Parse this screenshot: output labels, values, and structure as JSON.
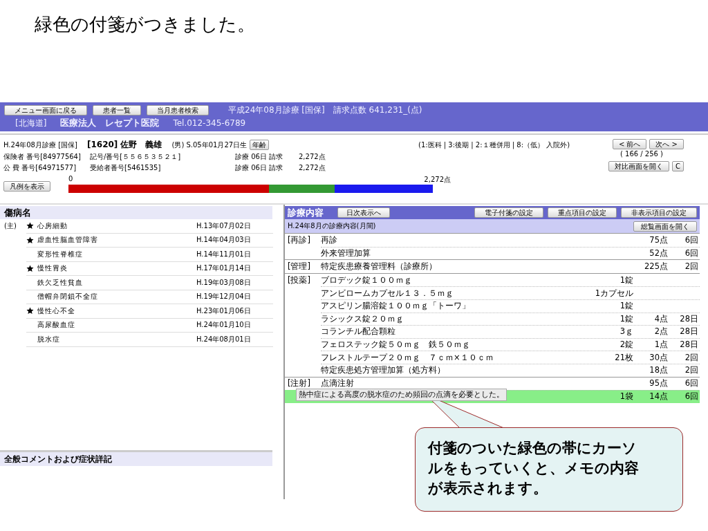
{
  "slide_title": "緑色の付箋がつきました。",
  "header": {
    "buttons": [
      "メニュー画面に戻る",
      "患者一覧",
      "当月患者検索"
    ],
    "title": "平成24年08月診療 [国保]　請求点数 641,231_(点)",
    "prefecture": "[北海道]",
    "clinic": "医療法人　レセプト医院",
    "tel": "Tel.012-345-6789"
  },
  "patient": {
    "month": "H.24年08月診療 [国保]",
    "name": "[1620] 佐野　義雄",
    "birth": "(男) S.05年01月27日生",
    "age_button": "年齢",
    "lines": [
      {
        "number": "保険者 番号[84977564]",
        "id": "記号/番号[５５６５３５２１]",
        "visits": "診療 06日 請求",
        "points": "2,272点"
      },
      {
        "number": "公 費 番号[64971577]",
        "id": "受給者番号[5461535]",
        "visits": "診療 06日 請求",
        "points": "2,272点"
      }
    ],
    "type": "(1:医科 | 3:後期 | 2:１種併用 | 8:（低） 入院外)",
    "prev_button": "< 前へ",
    "next_button": "次へ >",
    "counter": "( 166 / 256 )",
    "compare_button": "対比画面を開く",
    "clear_button": "C"
  },
  "legend_button": "凡例を表示",
  "bar": {
    "start_label": "0",
    "end_label": "2,272点",
    "segments": [
      {
        "color": "#cc0000"
      },
      {
        "color": "#339933"
      },
      {
        "color": "#1a1aee"
      }
    ]
  },
  "diseases": {
    "title": "傷病名",
    "rows": [
      {
        "prefix": "(主)",
        "starred": true,
        "name": "心房細動",
        "date": "H.13年07月02日"
      },
      {
        "starred": true,
        "name": "虚血性脳血管障害",
        "date": "H.14年04月03日"
      },
      {
        "starred": false,
        "name": "変形性脊椎症",
        "date": "H.14年11月01日"
      },
      {
        "starred": true,
        "name": "慢性胃炎",
        "date": "H.17年01月14日"
      },
      {
        "starred": false,
        "name": "鉄欠乏性貧血",
        "date": "H.19年03月08日"
      },
      {
        "starred": false,
        "name": "僧帽弁閉鎖不全症",
        "date": "H.19年12月04日"
      },
      {
        "starred": true,
        "name": "慢性心不全",
        "date": "H.23年01月06日"
      },
      {
        "starred": false,
        "name": "高尿酸血症",
        "date": "H.24年01月10日"
      },
      {
        "starred": false,
        "name": "脱水症",
        "date": "H.24年08月01日"
      }
    ]
  },
  "comment_panel": {
    "title": "全般コメントおよび症状詳記"
  },
  "treatment": {
    "title": "診療内容",
    "daily_button": "日次表示へ",
    "buttons": [
      "電子付箋の設定",
      "重点項目の設定",
      "非表示項目の設定"
    ],
    "subtitle": "H.24年8月の診療内容(月間)",
    "overview_button": "総覧画面を開く",
    "groups": [
      {
        "category": "[再診]",
        "items": [
          {
            "name": "再診",
            "points": "75点",
            "count": "6回",
            "sticky": false
          },
          {
            "name": "外来管理加算",
            "points": "52点",
            "count": "6回",
            "sticky": false
          }
        ]
      },
      {
        "category": "[管理]",
        "items": [
          {
            "name": "特定疾患療養管理料（診療所）",
            "points": "225点",
            "count": "2回",
            "sticky": false
          }
        ]
      },
      {
        "category": "[投薬]",
        "items": [
          {
            "name": "ブロデック錠１００ｍｇ",
            "qty": "1錠",
            "sticky": false
          },
          {
            "name": "アンビロームカプセル１３．５ｍｇ",
            "qty": "1カプセル",
            "sticky": false
          },
          {
            "name": "アスピリン腸溶錠１００ｍｇ「トーワ」",
            "qty": "1錠",
            "sticky": false
          },
          {
            "name": "ラシックス錠２０ｍｇ",
            "qty": "1錠",
            "points": "4点",
            "count": "28日",
            "sticky": false
          },
          {
            "name": "コランチル配合顆粒",
            "qty": "3ｇ",
            "points": "2点",
            "count": "28日",
            "sticky": false
          },
          {
            "name": "フェロステック錠５０ｍｇ　鉄５０ｍｇ",
            "qty": "2錠",
            "points": "1点",
            "count": "28日",
            "sticky": false
          },
          {
            "name": "フレストルテープ２０ｍｇ　７ｃｍ×１０ｃｍ",
            "qty": "21枚",
            "points": "30点",
            "count": "2回",
            "sticky": false
          },
          {
            "name": "特定疾患処方管理加算（処方料）",
            "points": "18点",
            "count": "2回",
            "sticky": false
          }
        ]
      },
      {
        "category": "[注射]",
        "items": [
          {
            "name": "点滴注射",
            "points": "95点",
            "count": "6回",
            "sticky": false
          },
          {
            "qty": "1袋",
            "points": "14点",
            "count": "6回",
            "sticky": true
          }
        ]
      }
    ]
  },
  "tooltip": "熱中症による高度の脱水症のため頻回の点滴を必要とした。",
  "callout": "付箋のついた緑色の帯にカーソルをもっていくと、メモの内容が表示されます。"
}
